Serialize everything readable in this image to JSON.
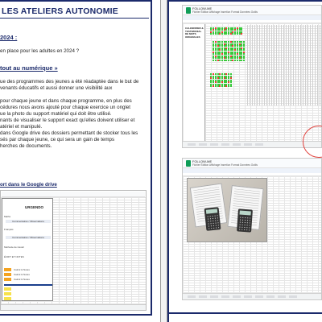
{
  "left_page": {
    "title": "LES ATELIERS AUTONOMIE",
    "section1_heading": "2024 :",
    "section1_line": "en place pour les adultes en 2024 ?",
    "section2_heading": "tout au numérique »",
    "paragraph_lines": [
      "ue des programmes des jeunes a été réadaptée dans le but de",
      "venants éducatifs et aussi donner une visibilité aux",
      "",
      "pour chaque jeune et dans chaque programme, en plus des",
      "cédures nous avons ajouté pour chaque exercice un onglet",
      "ue la photo du support matériel qui doit être utilisé.",
      "nants de visualiser le support exact qu'elles doivent utiliser et",
      "atériel et manipulé.",
      "dans Google drive des dossiers permettant de stocker tous les",
      "sés par chaque jeune, ce qui sera un gain de temps",
      "herches de documents."
    ],
    "caption": "ort dans le Google drive",
    "sheet": {
      "column_title": "URGENDO",
      "subheadings": [
        "Commentaires / Observations",
        "Commentaires / Observations"
      ],
      "row_labels": [
        "Maths",
        "Français",
        "Méthode de travail",
        "ÉCRIT ET NOTES",
        "Calcul & Notes",
        "Calcul & Notes",
        "Calcul & Notes"
      ],
      "colors": {
        "orange": "#f4a320",
        "yellow": "#f7e24a",
        "blue": "#1a3e8c"
      }
    }
  },
  "right_page": {
    "sheet_top": {
      "app_name": "FOLLOW-ME",
      "menu": "Fichier Édition Affichage Insertion Format Données Outils",
      "side_title": "CALENDRIER & TESTIMONIAL DE MOTS ORIGINALES",
      "colors": {
        "green": "#37c93a",
        "red": "#e8392f",
        "accent_circle": "#e0413c"
      }
    },
    "sheet_bottom": {
      "app_name": "FOLLOW-ME",
      "menu": "Fichier Édition Affichage Insertion Format Données Outils"
    }
  }
}
